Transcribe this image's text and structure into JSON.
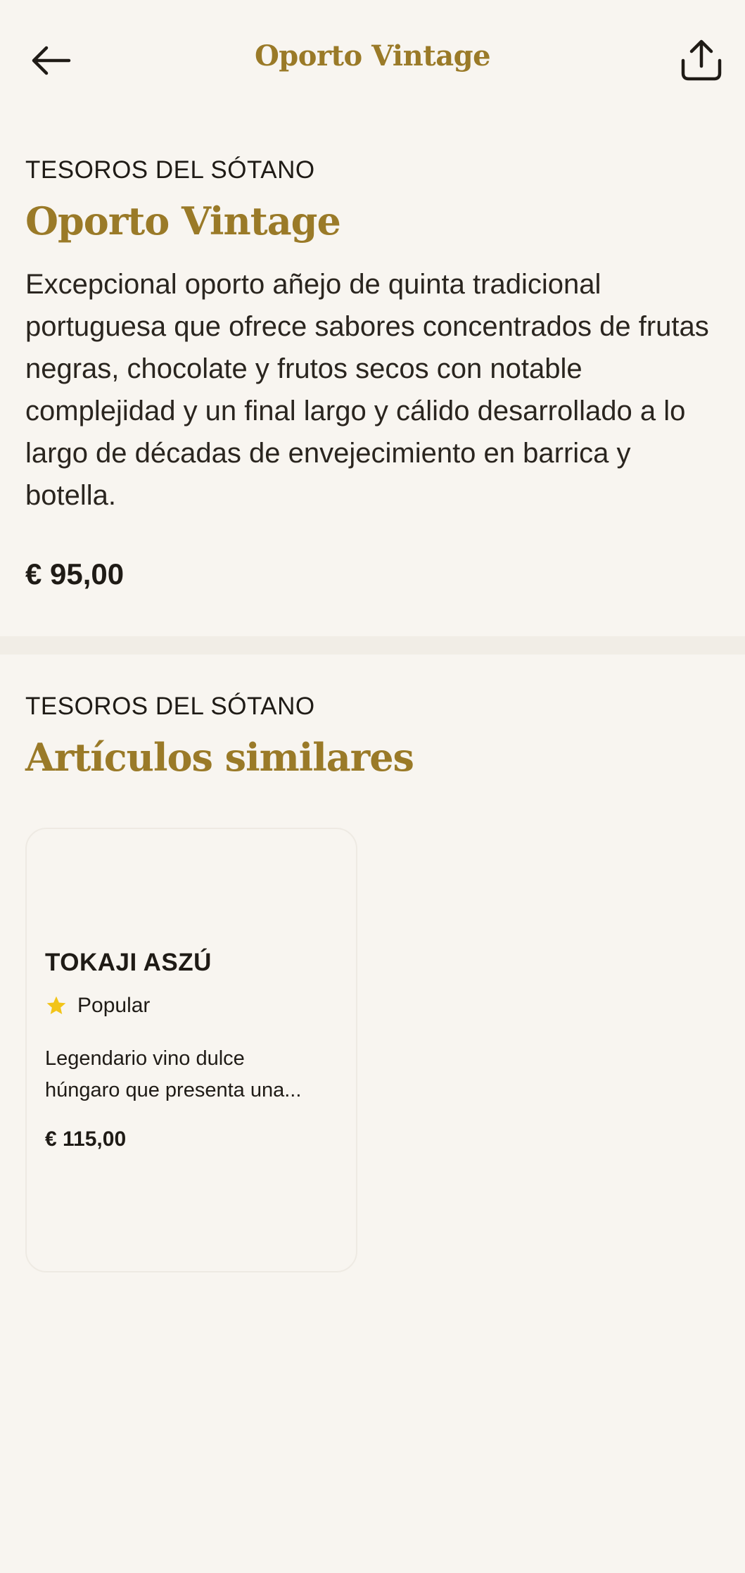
{
  "header": {
    "title": "Oporto Vintage",
    "back_icon": "arrow-left-icon",
    "share_icon": "share-icon"
  },
  "product": {
    "category": "TESOROS DEL SÓTANO",
    "name": "Oporto Vintage",
    "description": "Excepcional oporto añejo de quinta tradicional portuguesa que ofrece sabores concentrados de frutas negras, chocolate y frutos secos con notable complejidad y un final largo y cálido desarrollado a lo largo de décadas de envejecimiento en barrica y botella.",
    "price": "€ 95,00"
  },
  "similar": {
    "category": "TESOROS DEL SÓTANO",
    "title": "Artículos similares",
    "items": [
      {
        "name": "TOKAJI ASZÚ",
        "badge": "Popular",
        "badge_icon": "star-icon",
        "description_line1": "Legendario vino dulce",
        "description_line2": "húngaro que presenta una...",
        "price": "€ 115,00"
      }
    ]
  },
  "colors": {
    "background": "#f8f5f0",
    "accent_gold": "#9a7a28",
    "text": "#1f1b16",
    "star": "#f2c418",
    "divider": "#f1ede6"
  }
}
